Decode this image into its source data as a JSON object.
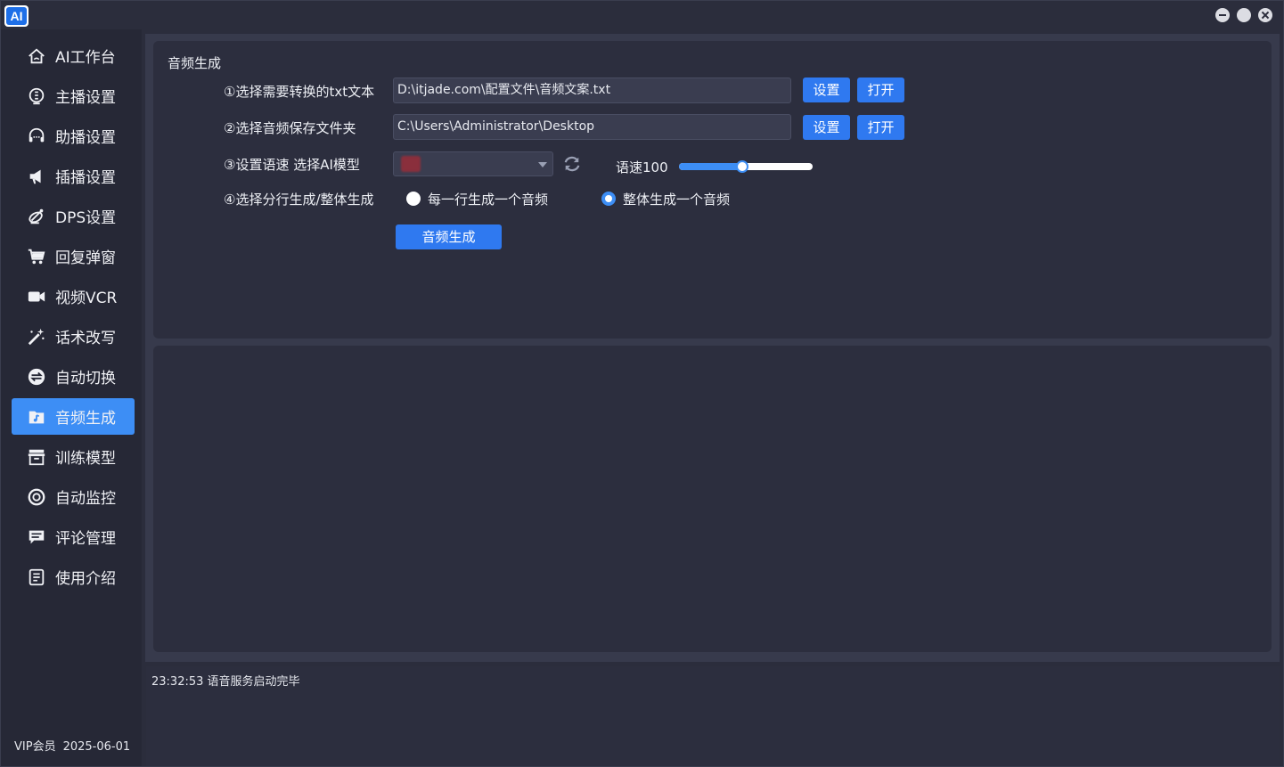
{
  "app": {
    "logo_text": "AI"
  },
  "sidebar": {
    "items": [
      {
        "label": "AI工作台",
        "icon": "home-icon"
      },
      {
        "label": "主播设置",
        "icon": "anchor-icon"
      },
      {
        "label": "助播设置",
        "icon": "headset-icon"
      },
      {
        "label": "插播设置",
        "icon": "megaphone-icon"
      },
      {
        "label": "DPS设置",
        "icon": "satellite-icon"
      },
      {
        "label": "回复弹窗",
        "icon": "cart-icon"
      },
      {
        "label": "视频VCR",
        "icon": "video-camera-icon"
      },
      {
        "label": "话术改写",
        "icon": "magic-wand-icon"
      },
      {
        "label": "自动切换",
        "icon": "switch-icon"
      },
      {
        "label": "音频生成",
        "icon": "audio-file-icon",
        "active": true
      },
      {
        "label": "训练模型",
        "icon": "archive-icon"
      },
      {
        "label": "自动监控",
        "icon": "monitor-icon"
      },
      {
        "label": "评论管理",
        "icon": "comment-icon"
      },
      {
        "label": "使用介绍",
        "icon": "document-icon"
      }
    ],
    "vip_label": "VIP会员",
    "vip_date": "2025-06-01"
  },
  "panel": {
    "title": "音频生成",
    "step1_label": "①选择需要转换的txt文本",
    "step1_path": "D:\\itjade.com\\配置文件\\音频文案.txt",
    "step2_label": "②选择音频保存文件夹",
    "step2_path": "C:\\Users\\Administrator\\Desktop",
    "set_label": "设置",
    "open_label": "打开",
    "step3_label": "③设置语速 选择AI模型",
    "speed_label": "语速100",
    "speed_fraction": 0.47,
    "step4_label": "④选择分行生成/整体生成",
    "option_per_line": "每一行生成一个音频",
    "option_whole": "整体生成一个音频",
    "selected_option": "whole",
    "generate_label": "音频生成"
  },
  "log": {
    "lines": [
      "23:32:53 语音服务启动完毕"
    ]
  },
  "colors": {
    "accent": "#3d8ef5",
    "button": "#2f79f0",
    "background": "#2b2d3c",
    "panel": "#2c2e3e"
  }
}
